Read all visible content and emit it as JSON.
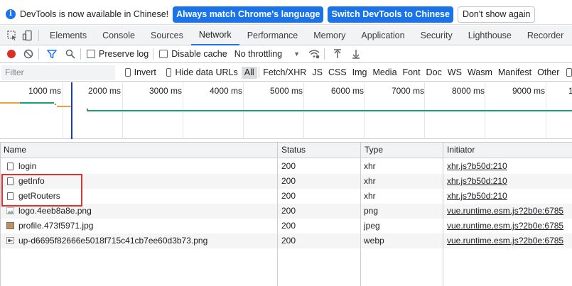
{
  "infobar": {
    "message": "DevTools is now available in Chinese!",
    "match_language_label": "Always match Chrome's language",
    "switch_label": "Switch DevTools to Chinese",
    "dismiss_label": "Don't show again"
  },
  "tabs": [
    "Elements",
    "Console",
    "Sources",
    "Network",
    "Performance",
    "Memory",
    "Application",
    "Security",
    "Lighthouse",
    "Recorder"
  ],
  "active_tab": "Network",
  "toolbar": {
    "preserve_log": "Preserve log",
    "disable_cache": "Disable cache",
    "throttling": "No throttling"
  },
  "filterbar": {
    "placeholder": "Filter",
    "invert": "Invert",
    "hide_data_urls": "Hide data URLs",
    "types": [
      "All",
      "Fetch/XHR",
      "JS",
      "CSS",
      "Img",
      "Media",
      "Font",
      "Doc",
      "WS",
      "Wasm",
      "Manifest",
      "Other"
    ],
    "selected_type": "All"
  },
  "overview": {
    "ticks": [
      "1000 ms",
      "2000 ms",
      "3000 ms",
      "4000 ms",
      "5000 ms",
      "6000 ms",
      "7000 ms",
      "8000 ms",
      "9000 ms",
      "1"
    ]
  },
  "table": {
    "headers": [
      "Name",
      "Status",
      "Type",
      "Initiator"
    ],
    "rows": [
      {
        "name": "login",
        "status": "200",
        "type": "xhr",
        "initiator": "xhr.js?b50d:210",
        "icon": "file-icon"
      },
      {
        "name": "getInfo",
        "status": "200",
        "type": "xhr",
        "initiator": "xhr.js?b50d:210",
        "icon": "file-icon"
      },
      {
        "name": "getRouters",
        "status": "200",
        "type": "xhr",
        "initiator": "xhr.js?b50d:210",
        "icon": "file-icon"
      },
      {
        "name": "logo.4eeb8a8e.png",
        "status": "200",
        "type": "png",
        "initiator": "vue.runtime.esm.js?2b0e:6785",
        "icon": "image-icon"
      },
      {
        "name": "profile.473f5971.jpg",
        "status": "200",
        "type": "jpeg",
        "initiator": "vue.runtime.esm.js?2b0e:6785",
        "icon": "photo-icon"
      },
      {
        "name": "up-d6695f82666e5018f715c41cb7ee60d3b73.png",
        "status": "200",
        "type": "webp",
        "initiator": "vue.runtime.esm.js?2b0e:6785",
        "icon": "image-icon"
      }
    ]
  },
  "colors": {
    "accent": "#1a73e8",
    "record": "#d93025",
    "highlight_box": "#e03131"
  }
}
